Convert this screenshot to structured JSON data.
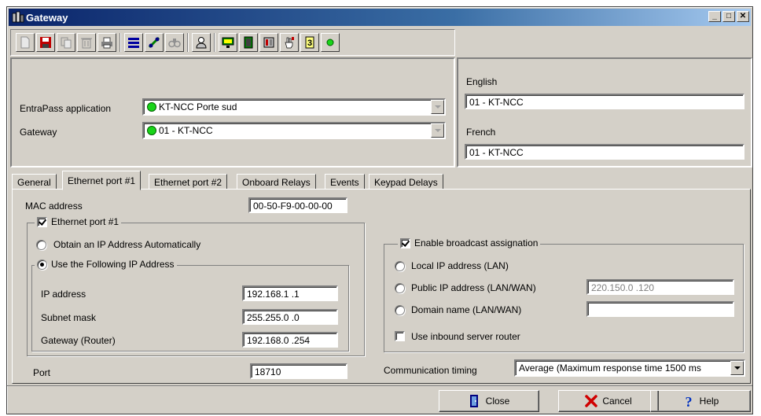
{
  "window": {
    "title": "Gateway",
    "minimize": "_",
    "maximize": "□",
    "close": "✕"
  },
  "toolbar": {
    "icons": [
      "new-icon",
      "save-icon",
      "copy-icon",
      "delete-icon",
      "print-icon",
      "list-icon",
      "link-icon",
      "find-icon",
      "users-icon",
      "monitor-icon",
      "door-icon",
      "panel-icon",
      "hand-icon",
      "help-icon",
      "status-led-icon"
    ]
  },
  "header": {
    "application_label": "EntraPass application",
    "application_value": "KT-NCC Porte sud",
    "gateway_label": "Gateway",
    "gateway_value": "01 - KT-NCC"
  },
  "language": {
    "english_label": "English",
    "english_value": "01 - KT-NCC",
    "french_label": "French",
    "french_value": "01 - KT-NCC"
  },
  "tabs": [
    "General",
    "Ethernet port #1",
    "Ethernet port #2",
    "Onboard Relays",
    "Events",
    "Keypad Delays"
  ],
  "ethernet": {
    "mac_label": "MAC address",
    "mac_value": "00-50-F9-00-00-00",
    "port_enable_label": "Ethernet port #1",
    "obtain_auto_label": "Obtain an IP Address Automatically",
    "use_following_label": "Use the Following IP Address",
    "ip_label": "IP address",
    "ip_value": "192.168.1  .1",
    "subnet_label": "Subnet mask",
    "subnet_value": "255.255.0  .0",
    "gateway_label": "Gateway (Router)",
    "gateway_value": "192.168.0  .254",
    "port_label": "Port",
    "port_value": "18710"
  },
  "broadcast": {
    "enable_label": "Enable broadcast assignation",
    "local_label": "Local IP address (LAN)",
    "public_label": "Public IP address (LAN/WAN)",
    "public_value": "220.150.0  .120",
    "domain_label": "Domain name (LAN/WAN)",
    "domain_value": "",
    "inbound_label": "Use inbound server router"
  },
  "timing": {
    "label": "Communication timing",
    "value": "Average (Maximum response time 1500 ms"
  },
  "buttons": {
    "close": "Close",
    "cancel": "Cancel",
    "help": "Help"
  }
}
